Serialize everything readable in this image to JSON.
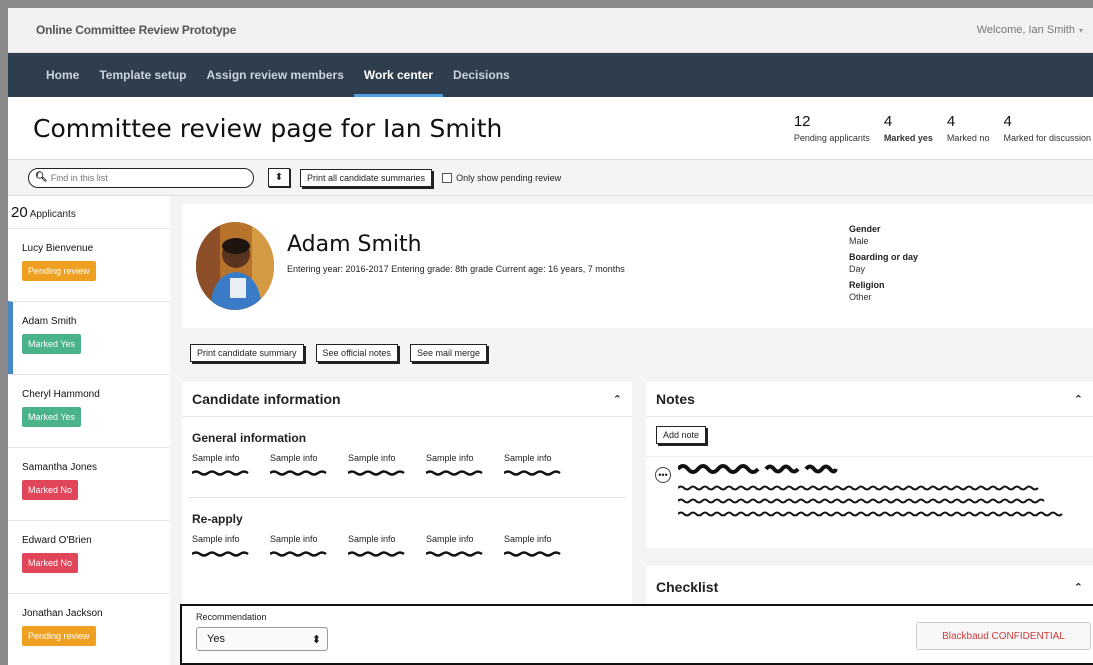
{
  "app": {
    "title": "Online Committee Review Prototype",
    "welcome": "Welcome, Ian Smith"
  },
  "nav": {
    "items": [
      {
        "label": "Home"
      },
      {
        "label": "Template setup"
      },
      {
        "label": "Assign review members"
      },
      {
        "label": "Work center"
      },
      {
        "label": "Decisions"
      }
    ],
    "active": "Work center"
  },
  "header": {
    "title": "Committee review page for Ian Smith",
    "stats": [
      {
        "value": "12",
        "label": "Pending applicants"
      },
      {
        "value": "4",
        "label": "Marked yes"
      },
      {
        "value": "4",
        "label": "Marked no"
      },
      {
        "value": "4",
        "label": "Marked for discussion"
      }
    ]
  },
  "toolbar": {
    "search_placeholder": "Find in this list",
    "sort_glyph": "⬍",
    "print_all_label": "Print all candidate summaries",
    "only_pending_label": "Only show pending review"
  },
  "sidebar": {
    "count": "20",
    "count_label": "Applicants",
    "applicants": [
      {
        "name": "Lucy Bienvenue",
        "status": "Pending review"
      },
      {
        "name": "Adam Smith",
        "status": "Marked Yes"
      },
      {
        "name": "Cheryl Hammond",
        "status": "Marked Yes"
      },
      {
        "name": "Samantha Jones",
        "status": "Marked No"
      },
      {
        "name": "Edward O'Brien",
        "status": "Marked No"
      },
      {
        "name": "Jonathan Jackson",
        "status": "Pending review"
      }
    ]
  },
  "candidate": {
    "name": "Adam Smith",
    "meta": "Entering year: 2016-2017   Entering grade: 8th grade   Current age: 16 years, 7 months",
    "gender_label": "Gender",
    "gender": "Male",
    "boarding_label": "Boarding or day",
    "boarding": "Day",
    "religion_label": "Religion",
    "religion": "Other"
  },
  "actions": {
    "print_summary": "Print candidate summary",
    "official_notes": "See official notes",
    "mail_merge": "See mail merge"
  },
  "candidate_info": {
    "title": "Candidate information",
    "collapse_glyph": "⌃",
    "sections": [
      {
        "title": "General information",
        "labels": [
          "Sample info",
          "Sample info",
          "Sample info",
          "Sample info",
          "Sample info"
        ]
      },
      {
        "title": "Re-apply",
        "labels": [
          "Sample info",
          "Sample info",
          "Sample info",
          "Sample info",
          "Sample info"
        ]
      }
    ]
  },
  "notes": {
    "title": "Notes",
    "collapse_glyph": "⌃",
    "add_label": "Add note",
    "more_glyph": "•••"
  },
  "checklist": {
    "title": "Checklist",
    "collapse_glyph": "⌃"
  },
  "recommendation": {
    "label": "Recommendation",
    "value": "Yes",
    "select_glyph": "⬍",
    "confidential": "Blackbaud CONFIDENTIAL"
  },
  "colors": {
    "nav_bg": "#2f3e4c",
    "nav_active_underline": "#4fa0e0",
    "pending": "#f0a020",
    "marked_yes": "#4ab38a",
    "marked_no": "#e0455a",
    "selected_bar": "#4a86c5",
    "confidential": "#d03a3a"
  }
}
